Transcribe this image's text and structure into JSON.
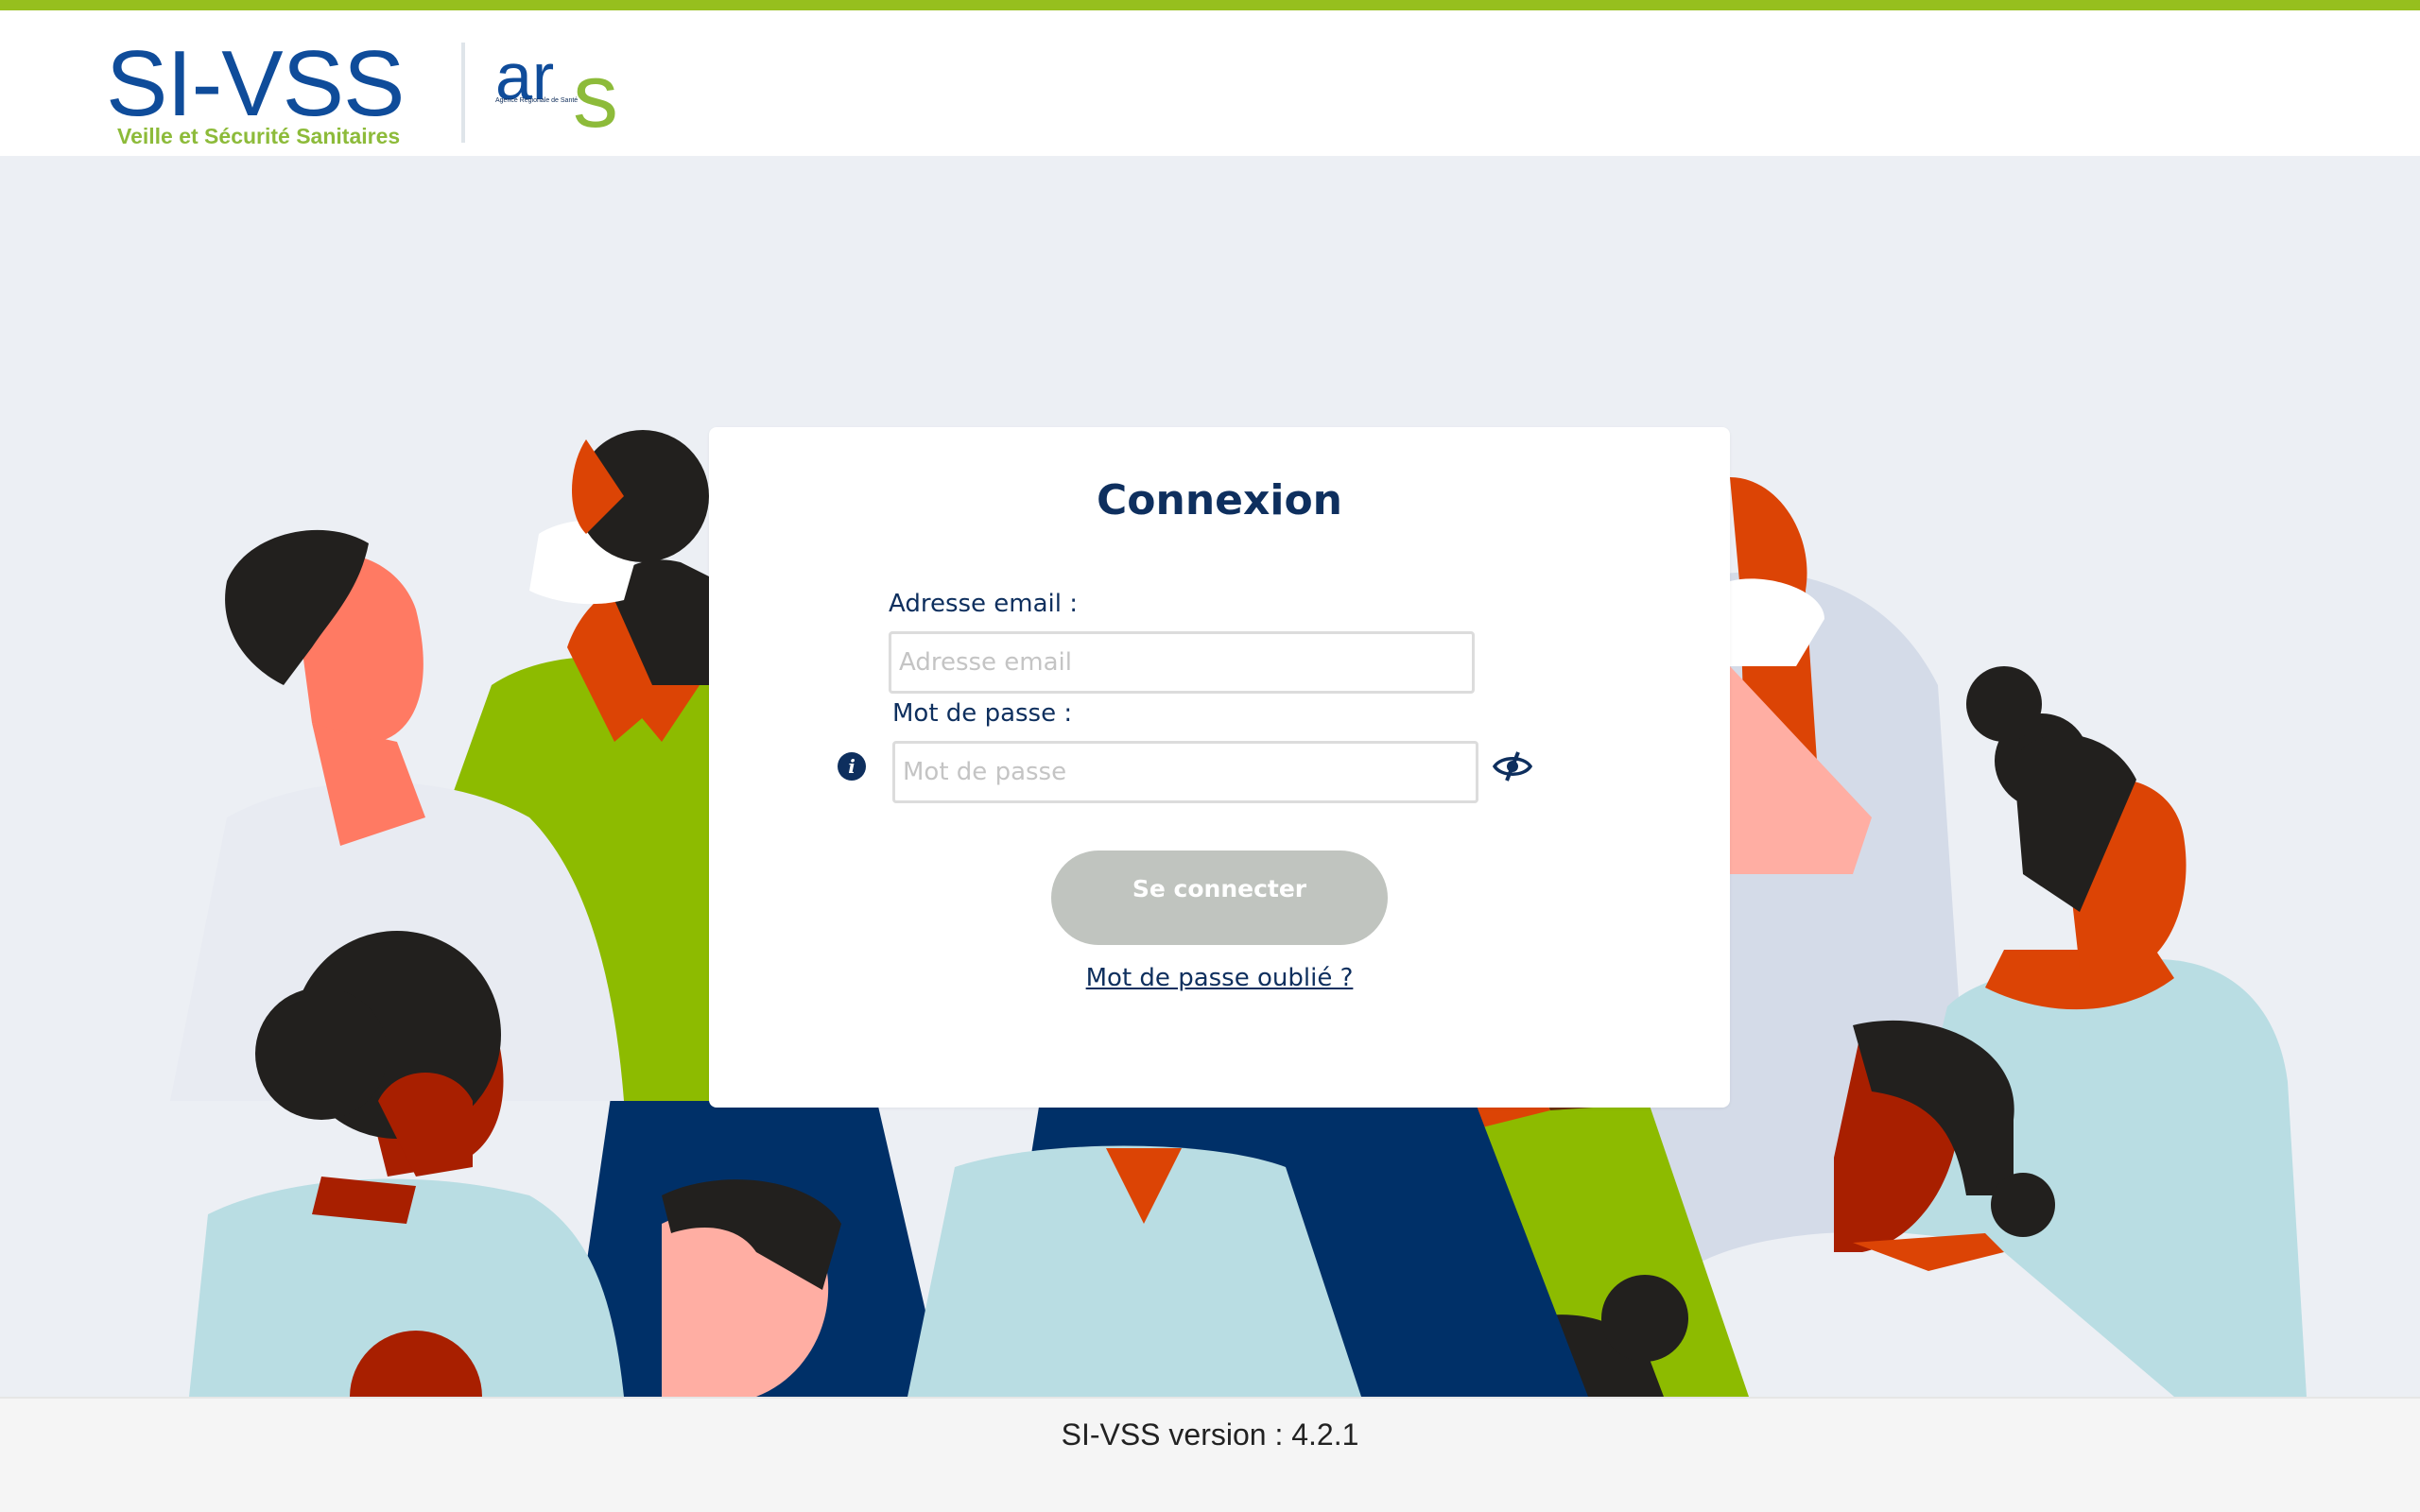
{
  "brand": {
    "logo_title": "SI-VSS",
    "logo_subtitle": "Veille et Sécurité Sanitaires",
    "partner_logo": "ars",
    "partner_subtitle": "Agence Régionale de Santé",
    "accent_color": "#96bf1e",
    "primary_color": "#0e2f5e"
  },
  "login": {
    "title": "Connexion",
    "email_label": "Adresse email :",
    "email_placeholder": "Adresse email",
    "email_value": "",
    "password_label": "Mot de passe :",
    "password_placeholder": "Mot de passe",
    "password_value": "",
    "info_icon": "info-icon",
    "toggle_icon": "eye-slash-icon",
    "submit_label": "Se connecter",
    "forgot_link": "Mot de passe oublié ?"
  },
  "footer": {
    "version_text": "SI-VSS version : 4.2.1"
  }
}
